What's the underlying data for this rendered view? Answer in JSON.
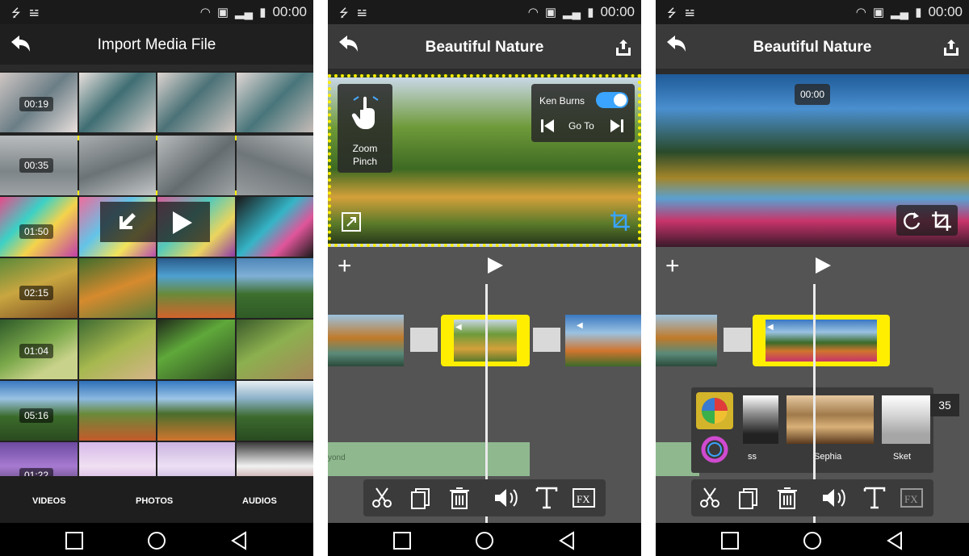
{
  "status_bar": {
    "time": "00:00"
  },
  "screen1": {
    "title": "Import Media File",
    "durations": [
      "00:19",
      "00:35",
      "01:50",
      "02:15",
      "01:04",
      "05:16",
      "01:22"
    ],
    "tabs": [
      "VIDEOS",
      "PHOTOS",
      "AUDIOS"
    ]
  },
  "screen2": {
    "title": "Beautiful Nature",
    "zoom_label": "Zoom\nPinch",
    "ken_burns_label": "Ken Burns",
    "goto_label": "Go To",
    "audio_track_label": "yond"
  },
  "screen3": {
    "title": "Beautiful Nature",
    "time_badge": "00:00",
    "filters": [
      "ss",
      "Sephia",
      "Sket"
    ],
    "side_number": "35"
  },
  "colors": {
    "accent_yellow": "#ffee00",
    "toggle_blue": "#3aa4ff"
  }
}
